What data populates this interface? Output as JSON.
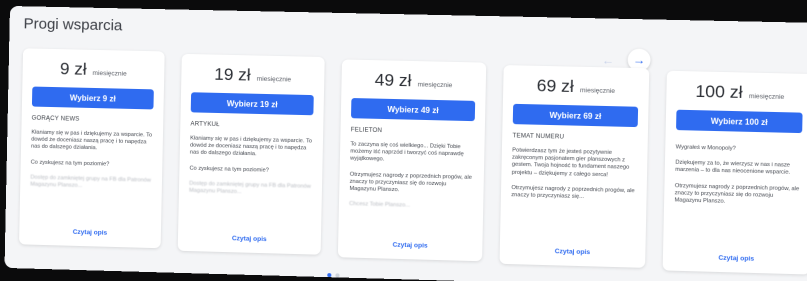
{
  "section": {
    "title": "Progi wsparcia"
  },
  "nav": {
    "prev": "←",
    "next": "→"
  },
  "cards": [
    {
      "price": "9 zł",
      "period": "miesięcznie",
      "button": "Wybierz 9 zł",
      "tier": "GORĄCY NEWS",
      "desc": "Kłaniamy się w pas i dziękujemy za wsparcie. To dowód że doceniasz naszą pracę i to napędza nas do dalszego działania.",
      "question": "Co zyskujesz na tym poziomie?",
      "faded": "Dostęp do zamkniętej grupy na FB dla Patronów Magazynu Planszo...",
      "link": "Czytaj opis"
    },
    {
      "price": "19 zł",
      "period": "miesięcznie",
      "button": "Wybierz 19 zł",
      "tier": "ARTYKUŁ",
      "desc": "Kłaniamy się w pas i dziękujemy za wsparcie. To dowód że doceniasz naszą pracę i to napędza nas do dalszego działania.",
      "question": "Co zyskujesz na tym poziomie?",
      "faded": "Dostęp do zamkniętej grupy na FB dla Patronów Magazynu Planszo...",
      "link": "Czytaj opis"
    },
    {
      "price": "49 zł",
      "period": "miesięcznie",
      "button": "Wybierz 49 zł",
      "tier": "FELIETON",
      "desc": "To zaczyna się coś wielkiego... Dzięki Tobie możemy iść naprzód i tworzyć coś naprawdę wyjątkowego.",
      "question": "Otrzymujesz nagrody z poprzednich progów, ale znaczy to przyczyniasz się do rozwoju Magazynu Planszo.",
      "faded": "Chcesz Tobie Planszo...",
      "link": "Czytaj opis"
    },
    {
      "price": "69 zł",
      "period": "miesięcznie",
      "button": "Wybierz 69 zł",
      "tier": "TEMAT NUMERU",
      "desc": "Potwierdzasz tym że jesteś pozytywnie zakręconym pasjonatem gier planszowych z gestem. Twoja hojność to fundament naszego projektu – dziękujemy z całego serca!",
      "question": "Otrzymujesz nagrody z poprzednich progów, ale znaczy to przyczyniasz się...",
      "faded": "",
      "link": "Czytaj opis"
    },
    {
      "price": "100 zł",
      "period": "miesięcznie",
      "button": "Wybierz 100 zł",
      "tier": "",
      "desc": "Wygrałeś w Monopoly?",
      "question": "Dziękujemy za to, że wierzysz w nas i nasze marzenia – to dla nas nieocenione wsparcie.",
      "faded": "Otrzymujesz nagrody z poprzednich progów, ale znaczy to przyczyniasz się do rozwoju Magazynu Planszo.",
      "link": "Czytaj opis"
    }
  ],
  "pagination": {
    "pages": 2,
    "active": 1
  }
}
